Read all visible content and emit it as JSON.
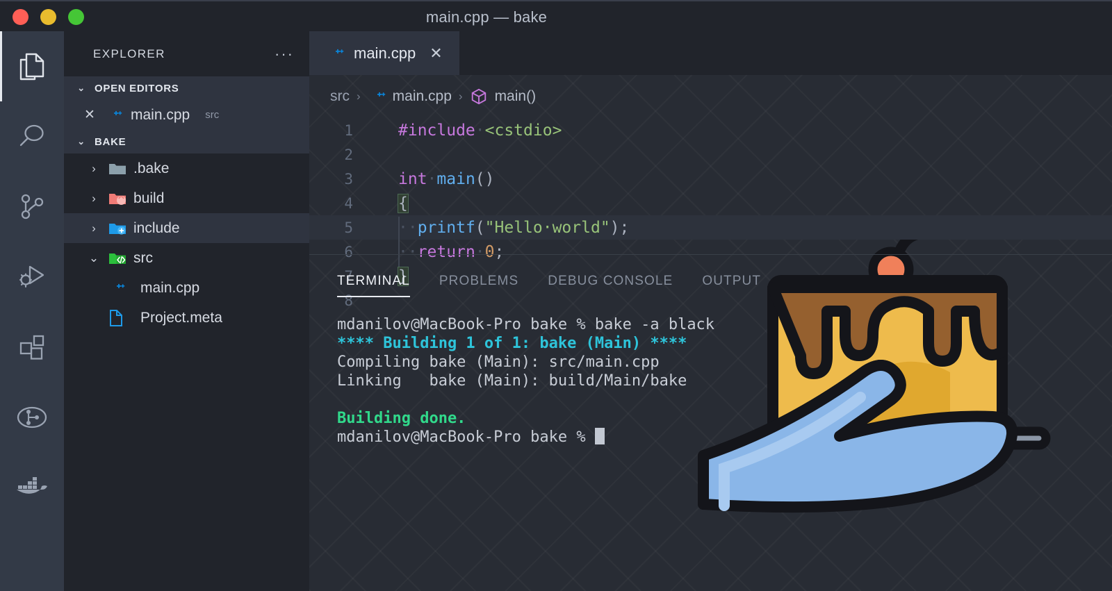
{
  "window": {
    "title": "main.cpp — bake",
    "traffic_lights": [
      "close",
      "minimize",
      "zoom"
    ]
  },
  "activity_bar": {
    "items": [
      {
        "name": "explorer",
        "icon": "files-icon",
        "active": true
      },
      {
        "name": "search",
        "icon": "search-icon",
        "active": false
      },
      {
        "name": "source-control",
        "icon": "source-control-icon",
        "active": false
      },
      {
        "name": "run-and-debug",
        "icon": "run-debug-icon",
        "active": false
      },
      {
        "name": "extensions",
        "icon": "extensions-icon",
        "active": false
      },
      {
        "name": "gitlens",
        "icon": "gitlens-icon",
        "active": false
      },
      {
        "name": "docker",
        "icon": "docker-icon",
        "active": false
      }
    ]
  },
  "sidebar": {
    "title": "EXPLORER",
    "more_label": "···",
    "open_editors": {
      "header": "OPEN EDITORS",
      "chevron": "⌄",
      "items": [
        {
          "close": "✕",
          "icon": "cpp-file-icon",
          "label": "main.cpp",
          "sub": "src"
        }
      ]
    },
    "workspace": {
      "header": "BAKE",
      "chevron": "⌄",
      "items": [
        {
          "arrow": "›",
          "icon": "folder-icon",
          "label": ".bake",
          "highlighted": false,
          "expanded": false
        },
        {
          "arrow": "›",
          "icon": "folder-build-icon",
          "label": "build",
          "highlighted": false,
          "expanded": false
        },
        {
          "arrow": "›",
          "icon": "folder-include-icon",
          "label": "include",
          "highlighted": true,
          "expanded": false
        },
        {
          "arrow": "⌄",
          "icon": "folder-src-icon",
          "label": "src",
          "highlighted": false,
          "expanded": true
        },
        {
          "arrow": "",
          "icon": "cpp-file-icon",
          "label": "main.cpp",
          "highlighted": false,
          "expanded": false
        },
        {
          "arrow": "",
          "icon": "meta-file-icon",
          "label": "Project.meta",
          "highlighted": false,
          "expanded": false
        }
      ]
    }
  },
  "editor": {
    "tab": {
      "icon": "cpp-file-icon",
      "label": "main.cpp",
      "close": "✕"
    },
    "breadcrumb": {
      "parts": [
        "src",
        "main.cpp",
        "main()"
      ],
      "separator": "›",
      "symbol_icon": "cube-icon"
    },
    "lines": [
      {
        "number": "1",
        "segments": [
          {
            "text": "#include",
            "cls": "kw"
          },
          {
            "text": "·",
            "cls": "dot"
          },
          {
            "text": "<cstdio>",
            "cls": "str"
          }
        ],
        "current": false,
        "indent_guide": false
      },
      {
        "number": "2",
        "segments": [],
        "current": false,
        "indent_guide": false
      },
      {
        "number": "3",
        "segments": [
          {
            "text": "int",
            "cls": "kw"
          },
          {
            "text": "·",
            "cls": "dot"
          },
          {
            "text": "main",
            "cls": "fn"
          },
          {
            "text": "()",
            "cls": "pln"
          }
        ],
        "current": false,
        "indent_guide": false
      },
      {
        "number": "4",
        "segments": [
          {
            "text": "{",
            "cls": "pln brk"
          }
        ],
        "current": false,
        "indent_guide": false
      },
      {
        "number": "5",
        "segments": [
          {
            "text": "··",
            "cls": "dot"
          },
          {
            "text": "printf",
            "cls": "fn"
          },
          {
            "text": "(",
            "cls": "pln"
          },
          {
            "text": "\"Hello·world\"",
            "cls": "str"
          },
          {
            "text": ");",
            "cls": "pln"
          }
        ],
        "current": true,
        "indent_guide": true
      },
      {
        "number": "6",
        "segments": [
          {
            "text": "··",
            "cls": "dot"
          },
          {
            "text": "return",
            "cls": "kw"
          },
          {
            "text": "·",
            "cls": "dot"
          },
          {
            "text": "0",
            "cls": "num"
          },
          {
            "text": ";",
            "cls": "pln"
          }
        ],
        "current": false,
        "indent_guide": true
      },
      {
        "number": "7",
        "segments": [
          {
            "text": "}",
            "cls": "pln brk"
          }
        ],
        "current": false,
        "indent_guide": false
      },
      {
        "number": "8",
        "segments": [],
        "current": false,
        "indent_guide": false
      }
    ]
  },
  "panel": {
    "tabs": [
      {
        "label": "TERMINAL",
        "active": true
      },
      {
        "label": "PROBLEMS",
        "active": false
      },
      {
        "label": "DEBUG CONSOLE",
        "active": false
      },
      {
        "label": "OUTPUT",
        "active": false
      }
    ],
    "terminal_lines": [
      [
        {
          "text": "mdanilov@MacBook-Pro bake % bake -a black",
          "cls": "t-plain"
        }
      ],
      [
        {
          "text": "**** Building 1 of 1: bake (Main) ****",
          "cls": "t-cyan"
        }
      ],
      [
        {
          "text": "Compiling bake (Main): src/main.cpp",
          "cls": "t-plain"
        }
      ],
      [
        {
          "text": "Linking   bake (Main): build/Main/bake",
          "cls": "t-plain"
        }
      ],
      [
        {
          "text": "",
          "cls": "t-plain"
        }
      ],
      [
        {
          "text": "Building done.",
          "cls": "t-green"
        }
      ],
      [
        {
          "text": "mdanilov@MacBook-Pro bake % ",
          "cls": "t-plain"
        },
        {
          "text": "",
          "cls": "cursor"
        }
      ]
    ]
  },
  "logo": {
    "name": "bake-cake-logo"
  },
  "colors": {
    "titlebar_bg": "#21242b",
    "activitybar_bg": "#333a47",
    "sidebar_bg": "#21242b",
    "editor_bg": "#282c34",
    "accent_blue": "#0a84d8",
    "terminal_cyan": "#2ec4da",
    "terminal_green": "#31d98b",
    "keyword_purple": "#c678dd",
    "string_green": "#98c379",
    "function_blue": "#61afef",
    "number_orange": "#d19a66",
    "cake_yellow": "#eebb4c",
    "cake_brown": "#95602f",
    "cake_cherry": "#f0805a",
    "hand_blue": "#8ab6e8"
  }
}
